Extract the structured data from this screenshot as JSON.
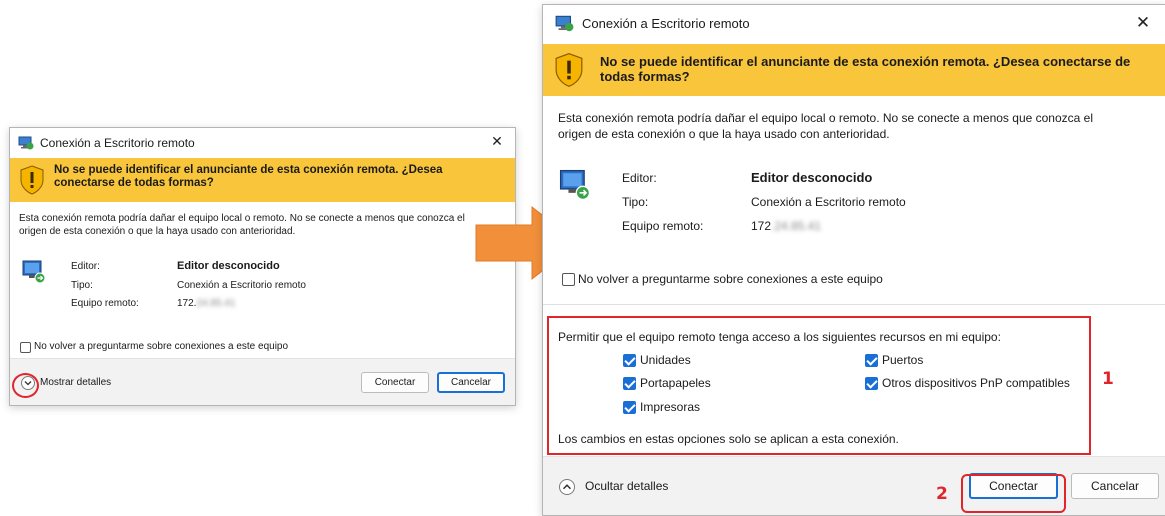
{
  "small_dialog": {
    "title": "Conexión a Escritorio remoto",
    "close_glyph": "✕",
    "warning_text": "No se puede identificar el anunciante de esta conexión remota. ¿Desea conectarse de todas formas?",
    "body_text": "Esta conexión remota podría dañar el equipo local o remoto. No se conecte a menos que conozca el origen de esta conexión o que la haya usado con anterioridad.",
    "editor_label": "Editor:",
    "editor_value": "Editor desconocido",
    "type_label": "Tipo:",
    "type_value": "Conexión a Escritorio remoto",
    "remote_label": "Equipo remoto:",
    "remote_value": "172.",
    "remote_blur": "24.85.41",
    "dont_ask_label": "No volver a preguntarme sobre conexiones a este equipo",
    "dont_ask_checked": false,
    "show_details": "Mostrar detalles",
    "connect_label": "Conectar",
    "cancel_label": "Cancelar"
  },
  "large_dialog": {
    "title": "Conexión a Escritorio remoto",
    "close_glyph": "✕",
    "warning_text": "No se puede identificar el anunciante de esta conexión remota. ¿Desea conectarse de todas formas?",
    "body_text": "Esta conexión remota podría dañar el equipo local o remoto. No se conecte a menos que conozca el origen de esta conexión o que la haya usado con anterioridad.",
    "editor_label": "Editor:",
    "editor_value": "Editor desconocido",
    "type_label": "Tipo:",
    "type_value": "Conexión a Escritorio remoto",
    "remote_label": "Equipo remoto:",
    "remote_value": "172",
    "remote_blur": ".24.85.41",
    "dont_ask_label": "No volver a preguntarme sobre conexiones a este equipo",
    "dont_ask_checked": false,
    "resources_heading": "Permitir que el equipo remoto tenga acceso a los siguientes recursos en mi equipo:",
    "resources": [
      {
        "label": "Unidades",
        "checked": true
      },
      {
        "label": "Portapapeles",
        "checked": true
      },
      {
        "label": "Impresoras",
        "checked": true
      },
      {
        "label": "Puertos",
        "checked": true
      },
      {
        "label": "Otros dispositivos PnP compatibles",
        "checked": true
      }
    ],
    "resources_note": "Los cambios en estas opciones solo se aplican a esta conexión.",
    "hide_details": "Ocultar detalles",
    "connect_label": "Conectar",
    "cancel_label": "Cancelar"
  },
  "annotations": {
    "step1": "1",
    "step2": "2",
    "accent_red": "#e0262b",
    "arrow_color": "#f28f3b",
    "warning_band_color": "#f8c53b"
  }
}
